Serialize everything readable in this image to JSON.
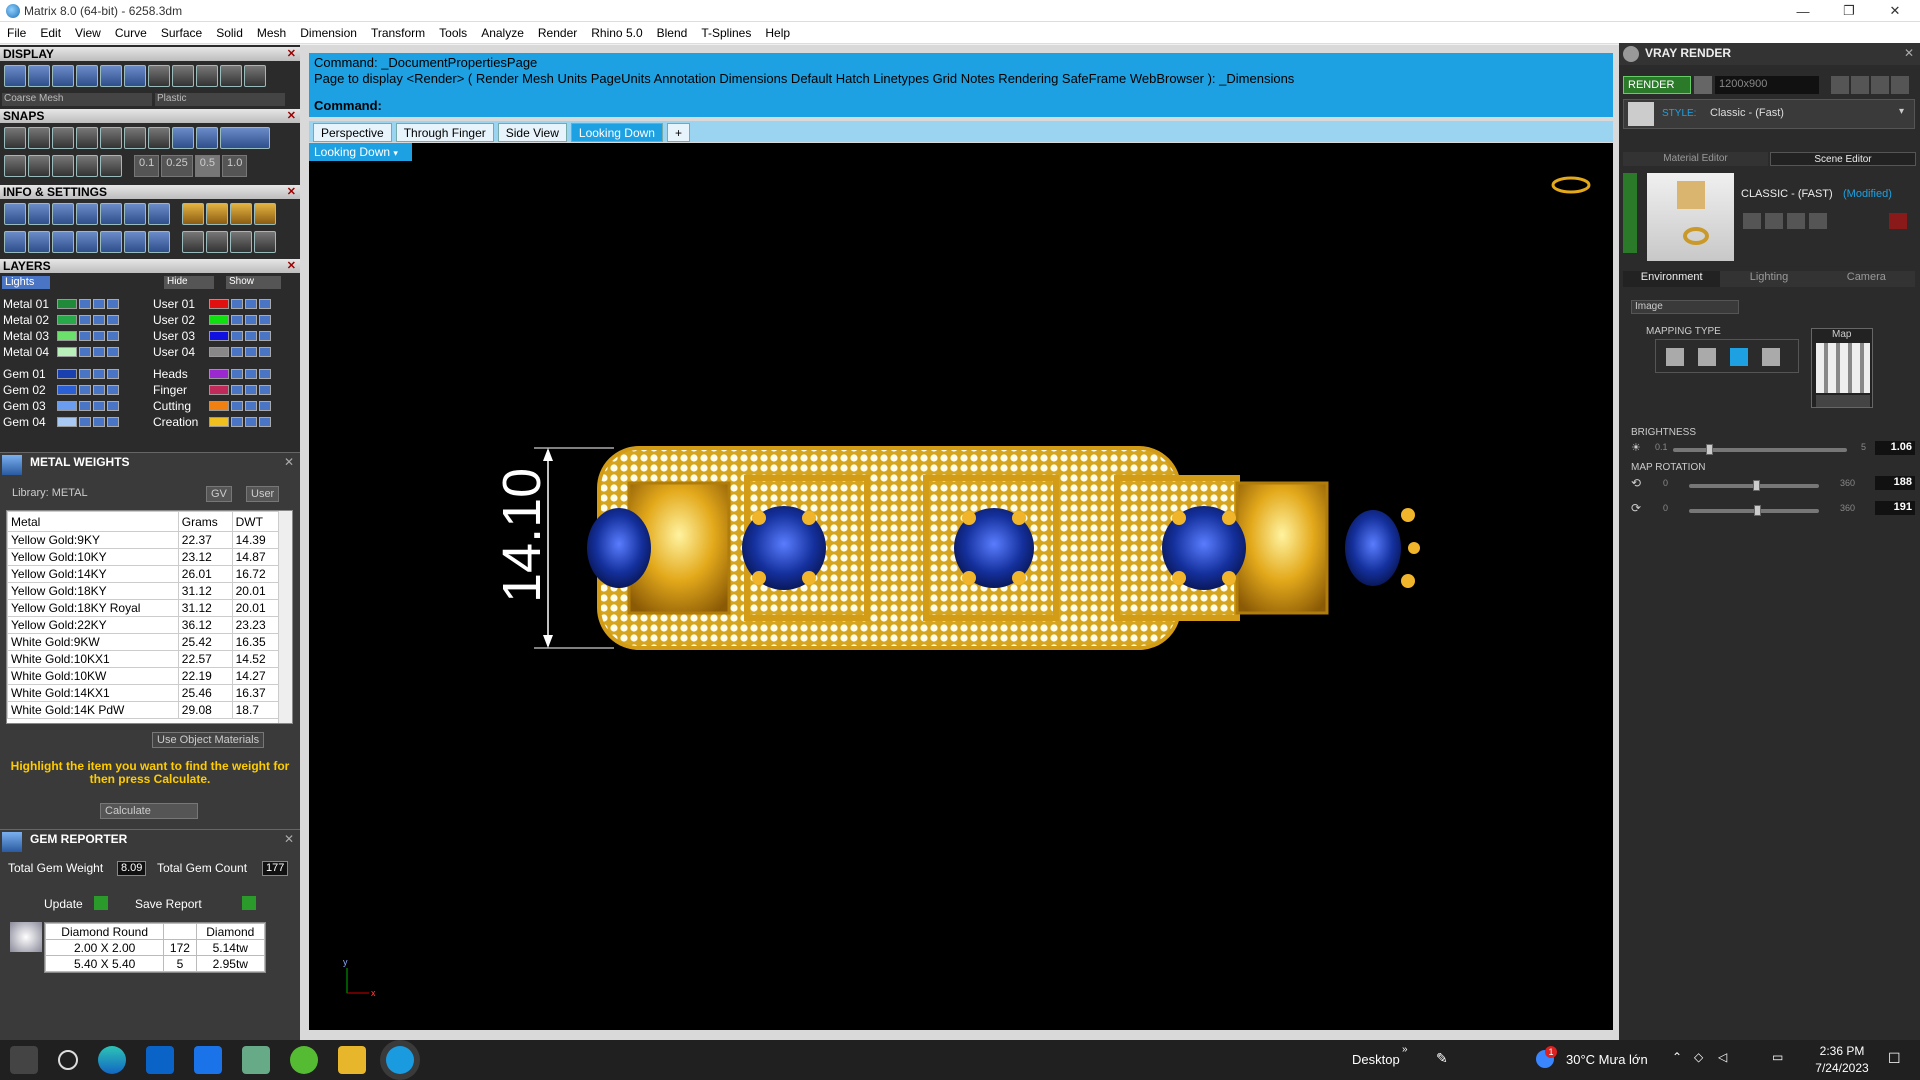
{
  "window": {
    "title": "Matrix 8.0 (64-bit) - 6258.3dm",
    "minimize": "—",
    "maximize": "❐",
    "close": "✕"
  },
  "menu": [
    "File",
    "Edit",
    "View",
    "Curve",
    "Surface",
    "Solid",
    "Mesh",
    "Dimension",
    "Transform",
    "Tools",
    "Analyze",
    "Render",
    "Rhino 5.0",
    "Blend",
    "T-Splines",
    "Help"
  ],
  "left": {
    "display_title": "DISPLAY",
    "display_sel1": "Coarse Mesh",
    "display_sel2": "Plastic",
    "snaps_title": "SNAPS",
    "snap_values": [
      "0.1",
      "0.25",
      "0.5",
      "1.0"
    ],
    "info_title": "INFO & SETTINGS",
    "layers_title": "LAYERS",
    "layer_active": "Lights",
    "hide_label": "Hide",
    "show_label": "Show",
    "layers_left": [
      {
        "name": "Metal 01",
        "color": "#1f8a3a"
      },
      {
        "name": "Metal 02",
        "color": "#27a94a"
      },
      {
        "name": "Metal 03",
        "color": "#6be06b"
      },
      {
        "name": "Metal 04",
        "color": "#b9f0b9"
      },
      {
        "name": "Gem 01",
        "color": "#1a3fae"
      },
      {
        "name": "Gem 02",
        "color": "#2a5fd6"
      },
      {
        "name": "Gem 03",
        "color": "#6a9cf0"
      },
      {
        "name": "Gem 04",
        "color": "#a9c9f5"
      }
    ],
    "layers_right": [
      {
        "name": "User 01",
        "color": "#e01010"
      },
      {
        "name": "User 02",
        "color": "#10e010"
      },
      {
        "name": "User 03",
        "color": "#1010e0"
      },
      {
        "name": "User 04",
        "color": "#888888"
      },
      {
        "name": "Heads",
        "color": "#9a2ad0"
      },
      {
        "name": "Finger",
        "color": "#c02a5a"
      },
      {
        "name": "Cutting",
        "color": "#f08010"
      },
      {
        "name": "Creation",
        "color": "#f0c020"
      }
    ],
    "mw_title": "METAL WEIGHTS",
    "library": "Library: METAL",
    "gv": "GV",
    "user": "User",
    "mw_headers": [
      "Metal",
      "Grams",
      "DWT"
    ],
    "mw_rows": [
      [
        "Yellow Gold:9KY",
        "22.37",
        "14.39"
      ],
      [
        "Yellow Gold:10KY",
        "23.12",
        "14.87"
      ],
      [
        "Yellow Gold:14KY",
        "26.01",
        "16.72"
      ],
      [
        "Yellow Gold:18KY",
        "31.12",
        "20.01"
      ],
      [
        "Yellow Gold:18KY Royal",
        "31.12",
        "20.01"
      ],
      [
        "Yellow Gold:22KY",
        "36.12",
        "23.23"
      ],
      [
        "White Gold:9KW",
        "25.42",
        "16.35"
      ],
      [
        "White Gold:10KX1",
        "22.57",
        "14.52"
      ],
      [
        "White Gold:10KW",
        "22.19",
        "14.27"
      ],
      [
        "White Gold:14KX1",
        "25.46",
        "16.37"
      ],
      [
        "White Gold:14K PdW",
        "29.08",
        "18.7"
      ]
    ],
    "use_object_materials": "Use Object Materials",
    "hint": "Highlight the item you want to find the weight for then press Calculate.",
    "calculate": "Calculate",
    "gem_title": "GEM REPORTER",
    "total_weight_label": "Total Gem Weight",
    "total_weight": "8.09",
    "total_count_label": "Total Gem Count",
    "total_count": "177",
    "update": "Update",
    "save_report": "Save Report",
    "gem_headers": [
      "Diamond Round",
      "",
      "Diamond"
    ],
    "gem_rows": [
      [
        "2.00 X 2.00",
        "172",
        "5.14tw"
      ],
      [
        "5.40 X 5.40",
        "5",
        "2.95tw"
      ]
    ]
  },
  "command": {
    "line1": "Command: _DocumentPropertiesPage",
    "line2": "Page to display <Render> ( Render  Mesh  Units  PageUnits  Annotation  Dimensions  Default  Hatch  Linetypes  Grid  Notes  Rendering  SafeFrame  WebBrowser ): _Dimensions",
    "prompt": "Command:"
  },
  "tabs": [
    "Perspective",
    "Through Finger",
    "Side View",
    "Looking Down"
  ],
  "tab_add": "+",
  "viewport": {
    "name": "Looking Down",
    "dimension": "14.10",
    "axis_y": "y",
    "axis_x": "x"
  },
  "right": {
    "title": "VRAY RENDER",
    "render": "RENDER",
    "resolution": "1200x900",
    "style_label": "STYLE:",
    "style_value": "Classic - (Fast)",
    "tab_material": "Material Editor",
    "tab_scene": "Scene Editor",
    "preset_name": "CLASSIC - (FAST)",
    "preset_modified": "(Modified)",
    "env_tabs": [
      "Environment",
      "Lighting",
      "Camera"
    ],
    "env_select": "Image",
    "mapping_type": "MAPPING TYPE",
    "map_label": "Map",
    "brightness_label": "BRIGHTNESS",
    "brightness_min": "0.1",
    "brightness_max": "5",
    "brightness_value": "1.06",
    "map_rotation_label": "MAP ROTATION",
    "rot1_min": "0",
    "rot1_max": "360",
    "rot1_value": "188",
    "rot2_min": "0",
    "rot2_max": "360",
    "rot2_value": "191",
    "accent": "#1ea1e2"
  },
  "taskbar": {
    "desktop": "Desktop",
    "weather": "30°C  Mưa lớn",
    "time": "2:36 PM",
    "date": "7/24/2023",
    "notif": "1"
  }
}
